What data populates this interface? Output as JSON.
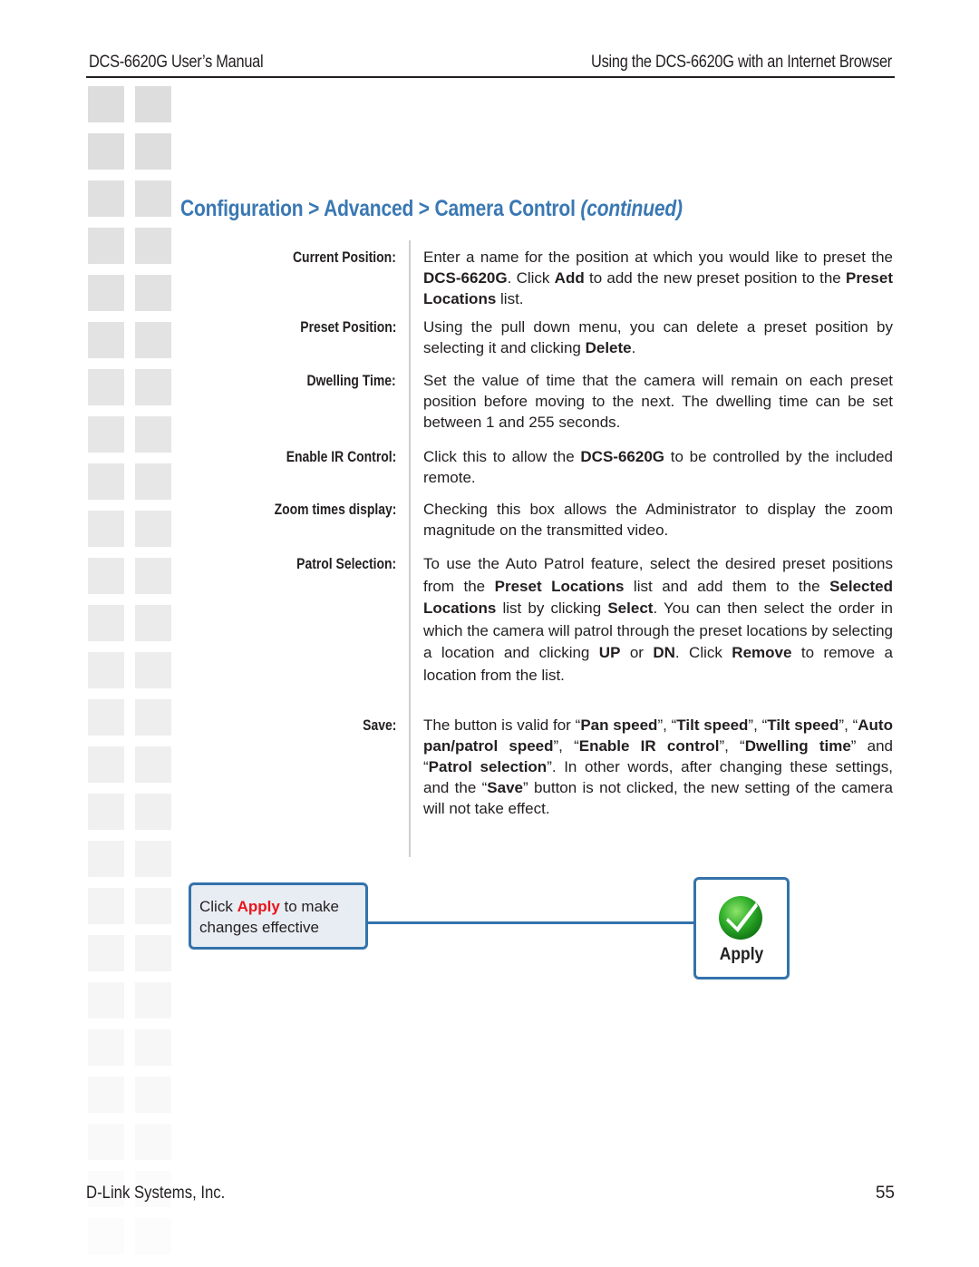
{
  "header": {
    "manual_title": "DCS-6620G User’s Manual",
    "section_title": "Using the DCS-6620G with an Internet Browser"
  },
  "page_title": {
    "breadcrumb": "Configuration > Advanced > Camera Control",
    "suffix": "(continued)",
    "color": "#3a78b3"
  },
  "settings": [
    {
      "label": "Current Position:",
      "description": [
        {
          "t": "Enter a name for the position at which you would like to preset the "
        },
        {
          "t": "DCS-6620G",
          "b": true
        },
        {
          "t": ". Click "
        },
        {
          "t": "Add",
          "b": true
        },
        {
          "t": " to add the new preset position to the "
        },
        {
          "t": "Preset Locations",
          "b": true
        },
        {
          "t": " list."
        }
      ]
    },
    {
      "label": "Preset Position:",
      "description": [
        {
          "t": "Using the pull down menu, you can delete a preset position by selecting it and clicking "
        },
        {
          "t": "Delete",
          "b": true
        },
        {
          "t": "."
        }
      ]
    },
    {
      "label": "Dwelling Time:",
      "description": [
        {
          "t": "Set the value of time that the camera will remain on each preset position before moving to the next. The dwelling time can be set between 1 and 255 seconds."
        }
      ]
    },
    {
      "label": "Enable IR Control:",
      "description": [
        {
          "t": "Click this to allow the "
        },
        {
          "t": "DCS-6620G",
          "b": true
        },
        {
          "t": " to be controlled by the included remote."
        }
      ]
    },
    {
      "label": "Zoom times display:",
      "description": [
        {
          "t": "Checking this box allows the Administrator to display the zoom magnitude on the transmitted video."
        }
      ]
    },
    {
      "label": "Patrol Selection:",
      "description": [
        {
          "t": "To use the Auto Patrol feature, select the desired preset positions from the "
        },
        {
          "t": "Preset Locations",
          "b": true
        },
        {
          "t": " list and add them to the "
        },
        {
          "t": "Selected Locations",
          "b": true
        },
        {
          "t": " list by clicking "
        },
        {
          "t": "Select",
          "b": true
        },
        {
          "t": ". You can then select the order in which the camera will patrol through the preset locations by selecting a location and clicking "
        },
        {
          "t": "UP",
          "b": true
        },
        {
          "t": " or "
        },
        {
          "t": "DN",
          "b": true
        },
        {
          "t": ". Click "
        },
        {
          "t": "Remove",
          "b": true
        },
        {
          "t": " to remove a location from the list."
        }
      ]
    },
    {
      "label": "Save:",
      "description": [
        {
          "t": "The button is valid for “"
        },
        {
          "t": "Pan speed",
          "b": true
        },
        {
          "t": "”, “"
        },
        {
          "t": "Tilt speed",
          "b": true
        },
        {
          "t": "”, “"
        },
        {
          "t": "Tilt speed",
          "b": true
        },
        {
          "t": "”, “"
        },
        {
          "t": "Auto pan/patrol speed",
          "b": true
        },
        {
          "t": "”, “"
        },
        {
          "t": "Enable IR control",
          "b": true
        },
        {
          "t": "”, “"
        },
        {
          "t": "Dwelling time",
          "b": true
        },
        {
          "t": "” and “"
        },
        {
          "t": "Patrol selection",
          "b": true
        },
        {
          "t": "”. In other words, after changing these settings, and the “"
        },
        {
          "t": "Save",
          "b": true
        },
        {
          "t": "” button is not clicked, the new setting of the camera will not take effect."
        }
      ]
    }
  ],
  "callout": {
    "prefix": "Click ",
    "highlight": "Apply",
    "suffix": " to make changes effective",
    "highlight_color": "#e8141b",
    "border_color": "#3373ab"
  },
  "apply_button": {
    "label": "Apply",
    "icon": "green-checkmark-icon"
  },
  "footer": {
    "company": "D-Link Systems, Inc.",
    "page_number": "55"
  }
}
